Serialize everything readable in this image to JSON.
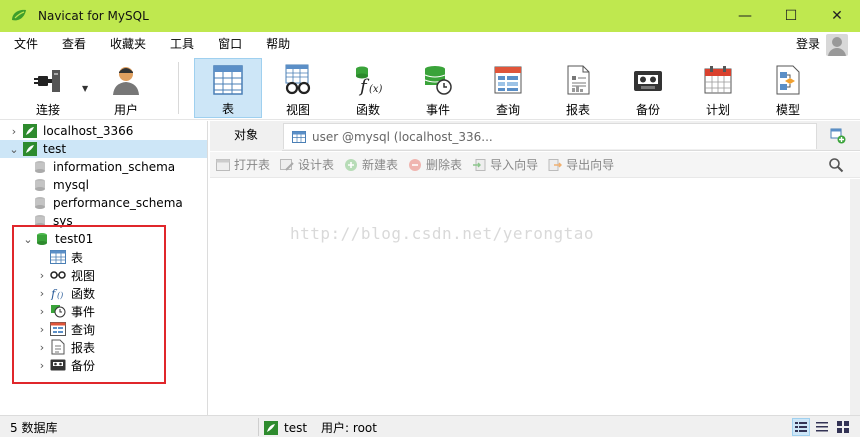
{
  "window": {
    "title": "Navicat for MySQL",
    "minimize": "—",
    "maximize": "☐",
    "close": "✕"
  },
  "menu": {
    "items": [
      "文件",
      "查看",
      "收藏夹",
      "工具",
      "窗口",
      "帮助"
    ],
    "login": "登录"
  },
  "toolbar": {
    "buttons": [
      {
        "label": "连接",
        "icon": "connection-plug-icon"
      },
      {
        "label": "用户",
        "icon": "user-icon"
      },
      {
        "label": "表",
        "icon": "table-icon"
      },
      {
        "label": "视图",
        "icon": "view-glasses-icon"
      },
      {
        "label": "函数",
        "icon": "function-icon"
      },
      {
        "label": "事件",
        "icon": "event-clock-icon"
      },
      {
        "label": "查询",
        "icon": "query-icon"
      },
      {
        "label": "报表",
        "icon": "report-icon"
      },
      {
        "label": "备份",
        "icon": "backup-tape-icon"
      },
      {
        "label": "计划",
        "icon": "schedule-calendar-icon"
      },
      {
        "label": "模型",
        "icon": "model-icon"
      }
    ],
    "active": "表"
  },
  "tree": {
    "connections": [
      {
        "label": "localhost_3366",
        "expanded": false
      },
      {
        "label": "test",
        "expanded": true
      }
    ],
    "databases": [
      "information_schema",
      "mysql",
      "performance_schema",
      "sys",
      "test01"
    ],
    "test01_children": [
      "表",
      "视图",
      "函数",
      "事件",
      "查询",
      "报表",
      "备份"
    ]
  },
  "tabs": {
    "objects": "对象",
    "query_tab": "user @mysql (localhost_336..."
  },
  "object_toolbar": {
    "buttons": [
      "打开表",
      "设计表",
      "新建表",
      "删除表",
      "导入向导",
      "导出向导"
    ]
  },
  "watermark": "http://blog.csdn.net/yerongtao",
  "status": {
    "db_count": "5 数据库",
    "connection": "test",
    "user": "用户: root"
  },
  "colors": {
    "titlebar": "#bfe84f",
    "selection": "#cde6f7",
    "highlight_box": "#e0262b",
    "db_icon_green": "#3aa33a"
  }
}
